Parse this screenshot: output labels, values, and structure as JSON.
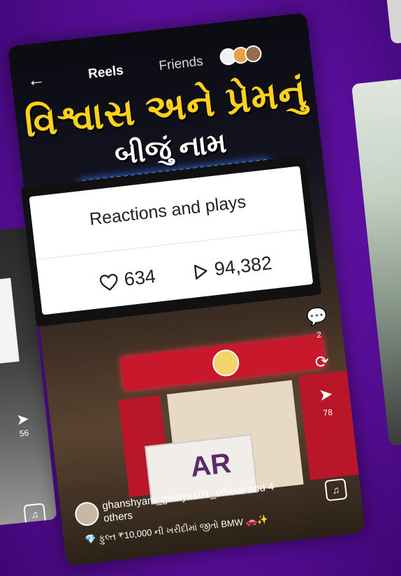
{
  "nav": {
    "back_label": "←",
    "tab_reels": "Reels",
    "tab_friends": "Friends"
  },
  "reel": {
    "headline_line1": "વિશ્વાસ અને પ્રેમનું",
    "headline_line2": "બીજું નામ",
    "ar_board_text": "AR"
  },
  "popup": {
    "title": "Reactions and plays",
    "likes": "634",
    "plays": "94,382"
  },
  "side_actions": {
    "comment_count": "2",
    "share_count": "78"
  },
  "caption": {
    "user_line": "ghanshyam_gediya101_official and 4 others",
    "text": "💎 ફુલ્ત ₹10,000 ની ખરીદીમાં જીતો BMW 🚗✨"
  },
  "left_card": {
    "share_count": "56"
  },
  "colors": {
    "background": "#5c0f9e",
    "headline_yellow": "#ffd21a",
    "popup_bg": "#ffffff"
  }
}
